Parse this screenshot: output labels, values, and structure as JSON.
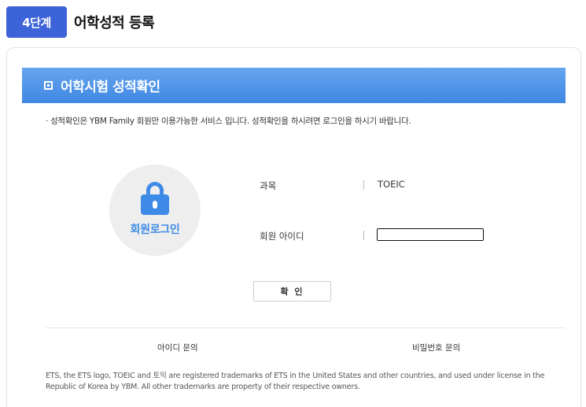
{
  "step": {
    "badge": "4단계",
    "title": "어학성적 등록"
  },
  "panel": {
    "title": "어학시험 성적확인",
    "notice": "· 성적확인은 YBM Family 회원만 이용가능한 서비스 입니다. 성적확인을 하시려면 로그인을 하시기 바랍니다."
  },
  "login": {
    "circle_label": "회원로그인",
    "subject_label": "과목",
    "subject_value": "TOEIC",
    "id_label": "회원 아이디",
    "id_value": "",
    "confirm_label": "확 인"
  },
  "links": {
    "find_id": "아이디 문의",
    "find_password": "비밀번호 문의"
  },
  "footer": {
    "trademark": "ETS, the ETS logo, TOEIC and 토익 are registered trademarks of ETS in the United States and other countries, and used under license in the Republic of Korea by YBM. All other trademarks are property of their respective owners."
  },
  "colors": {
    "accent": "#3d63d9",
    "panel_header": "#4a8fe7",
    "lock_icon": "#3d8be6"
  }
}
